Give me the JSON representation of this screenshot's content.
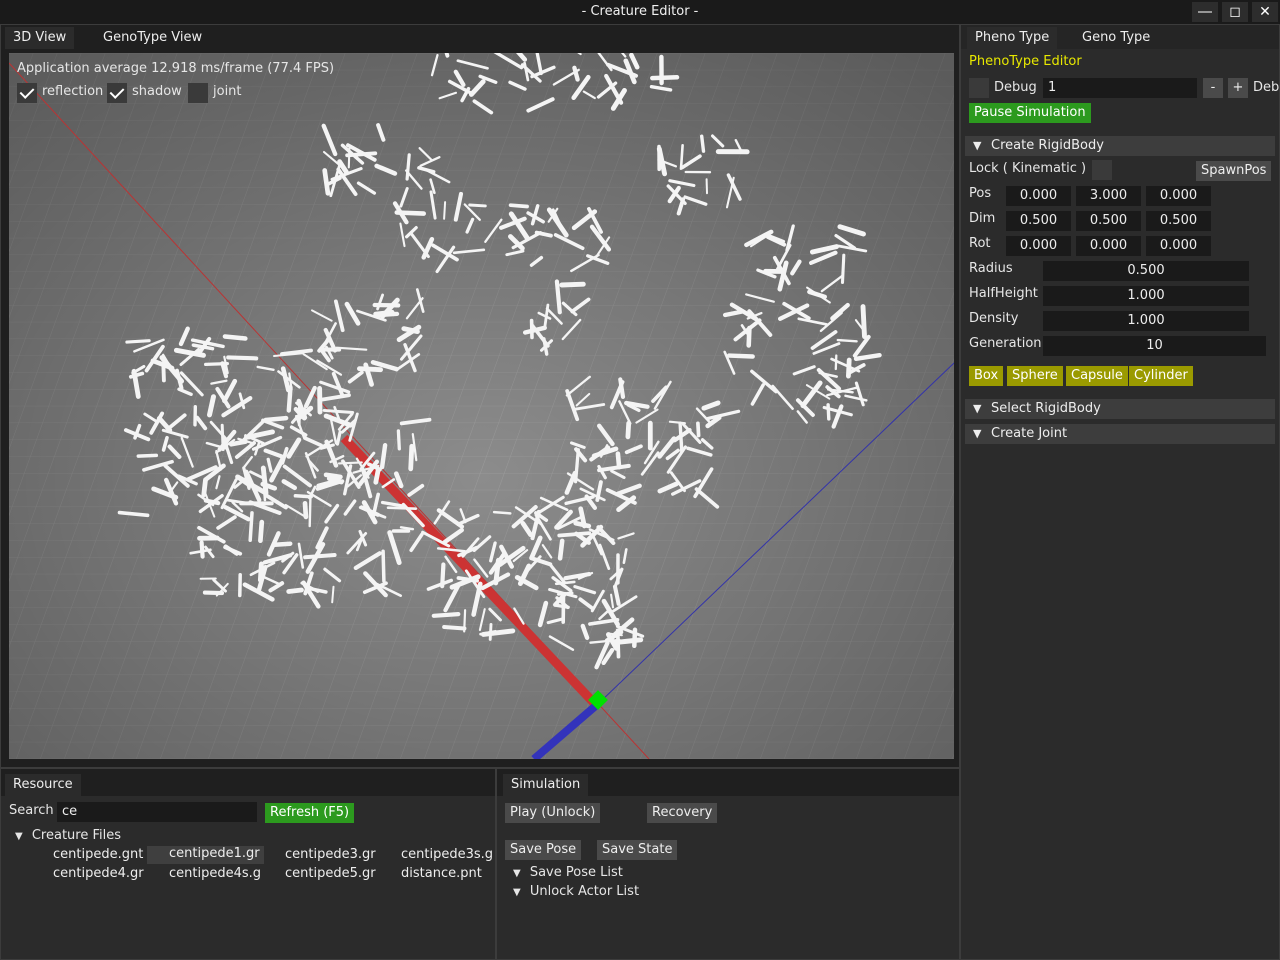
{
  "window": {
    "title": "- Creature Editor -"
  },
  "left_tabs": [
    "3D View",
    "GenoType View"
  ],
  "viewport": {
    "fps_text": "Application average 12.918 ms/frame (77.4 FPS)",
    "checkboxes": [
      {
        "label": "reflection",
        "checked": true
      },
      {
        "label": "shadow",
        "checked": true
      },
      {
        "label": "joint",
        "checked": false
      }
    ]
  },
  "right_tabs": [
    "Pheno Type",
    "Geno Type"
  ],
  "pheno_editor": {
    "title": "PhenoType Editor",
    "debug_label": "Debug",
    "debug_value": "1",
    "minus": "-",
    "plus": "+",
    "cut_label": "Deb",
    "pause_button": "Pause Simulation",
    "create_rigidbody": "Create RigidBody",
    "lock_label": "Lock ( Kinematic )",
    "spawnpos_button": "SpawnPos",
    "pos_label": "Pos",
    "pos": [
      "0.000",
      "3.000",
      "0.000"
    ],
    "dim_label": "Dim",
    "dim": [
      "0.500",
      "0.500",
      "0.500"
    ],
    "rot_label": "Rot",
    "rot": [
      "0.000",
      "0.000",
      "0.000"
    ],
    "radius_label": "Radius",
    "radius": "0.500",
    "halfheight_label": "HalfHeight",
    "halfheight": "1.000",
    "density_label": "Density",
    "density": "1.000",
    "generation_label": "Generation",
    "generation": "10",
    "shape_buttons": [
      "Box",
      "Sphere",
      "Capsule",
      "Cylinder"
    ],
    "select_rigidbody": "Select RigidBody",
    "create_joint": "Create Joint"
  },
  "resource": {
    "tab": "Resource",
    "search_label": "Search",
    "search_value": "ce",
    "refresh_button": "Refresh (F5)",
    "tree_label": "Creature Files",
    "files": [
      "centipede.gnt",
      "centipede1.gr",
      "centipede3.gr",
      "centipede3s.g",
      "centipede4.gr",
      "centipede4s.g",
      "centipede5.gr",
      "distance.pnt"
    ]
  },
  "simulation": {
    "tab": "Simulation",
    "play_button": "Play (Unlock)",
    "recovery_button": "Recovery",
    "save_pose_button": "Save Pose",
    "save_state_button": "Save State",
    "save_pose_list": "Save Pose List",
    "unlock_actor_list": "Unlock Actor List"
  },
  "colors": {
    "accent_green": "#2c9a1e",
    "accent_yellow": "#9a9a00",
    "title_yellow": "#e8e800",
    "viewport_floor": "#8a8a8a"
  }
}
